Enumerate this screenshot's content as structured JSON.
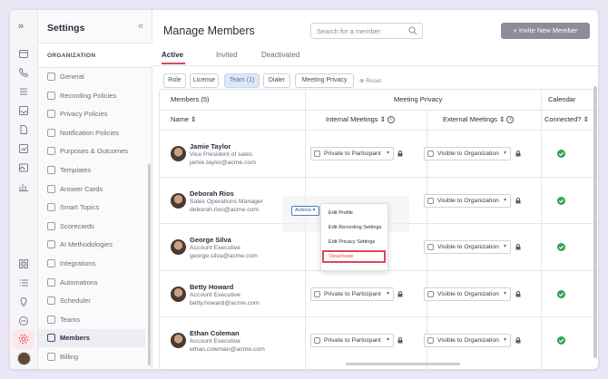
{
  "sidebar": {
    "title": "Settings",
    "collapse_glyph": "«",
    "section": "ORGANIZATION",
    "items": [
      {
        "label": "General"
      },
      {
        "label": "Recording Policies"
      },
      {
        "label": "Privacy Policies"
      },
      {
        "label": "Notification Policies"
      },
      {
        "label": "Purposes & Outcomes"
      },
      {
        "label": "Templates"
      },
      {
        "label": "Answer Cards"
      },
      {
        "label": "Smart Topics"
      },
      {
        "label": "Scorecards"
      },
      {
        "label": "AI Methodologies"
      },
      {
        "label": "Integrations"
      },
      {
        "label": "Automations"
      },
      {
        "label": "Scheduler"
      },
      {
        "label": "Teams"
      },
      {
        "label": "Members",
        "selected": true
      },
      {
        "label": "Billing"
      }
    ]
  },
  "rail": {
    "expand_glyph": "»",
    "icons": [
      "calendar-icon",
      "phone-icon",
      "list-icon",
      "inbox-icon",
      "document-icon",
      "chart-icon",
      "image-icon",
      "report-icon",
      "apps-icon",
      "checklist-icon",
      "lightbulb-icon",
      "minus-circle-icon",
      "settings-icon"
    ]
  },
  "header": {
    "title": "Manage Members",
    "search_placeholder": "Search for a member",
    "invite_label": "+ Invite New Member"
  },
  "tabs": [
    {
      "label": "Active",
      "active": true
    },
    {
      "label": "Invited"
    },
    {
      "label": "Deactivated"
    }
  ],
  "filters": [
    {
      "label": "Role"
    },
    {
      "label": "License"
    },
    {
      "label": "Team (1)",
      "active": true
    },
    {
      "label": "Dialer"
    },
    {
      "label": "Meeting Privacy"
    }
  ],
  "reset_label": "Reset",
  "table": {
    "members_group": "Members (5)",
    "privacy_group": "Meeting Privacy",
    "calendar_group": "Calendar",
    "col_name": "Name ⇕",
    "col_internal": "Internal Meetings ⇕",
    "col_external": "External Meetings ⇕",
    "col_connected": "Connected? ⇕",
    "rows": [
      {
        "name": "Jamie Taylor",
        "title": "Vice President of sales",
        "email": "jamie.taylor@acme.com",
        "internal": "Private to Participant",
        "external": "Visible to Organization"
      },
      {
        "name": "Deborah Rios",
        "title": "Sales Operations Manager",
        "email": "deborah.rios@acme.com",
        "internal": "",
        "external": "Visible to Organization"
      },
      {
        "name": "George Silva",
        "title": "Account Executive",
        "email": "george.silva@acme.com",
        "internal": "",
        "external": "Visible to Organization"
      },
      {
        "name": "Betty Howard",
        "title": "Account Executive",
        "email": "betty.howard@acme.com",
        "internal": "Private to Participant",
        "external": "Visible to Organization"
      },
      {
        "name": "Ethan Coleman",
        "title": "Account Executive",
        "email": "ethan.coleman@acme.com",
        "internal": "Private to Participant",
        "external": "Visible to Organization"
      }
    ]
  },
  "actions": {
    "button_label": "Actions",
    "menu": [
      "Edit Profile",
      "Edit Recording Settings",
      "Edit Privacy Settings",
      "Deactivate"
    ]
  },
  "colors": {
    "accent": "#e0455c",
    "success": "#2ea44f",
    "selected_filter": "#dce9f6"
  }
}
